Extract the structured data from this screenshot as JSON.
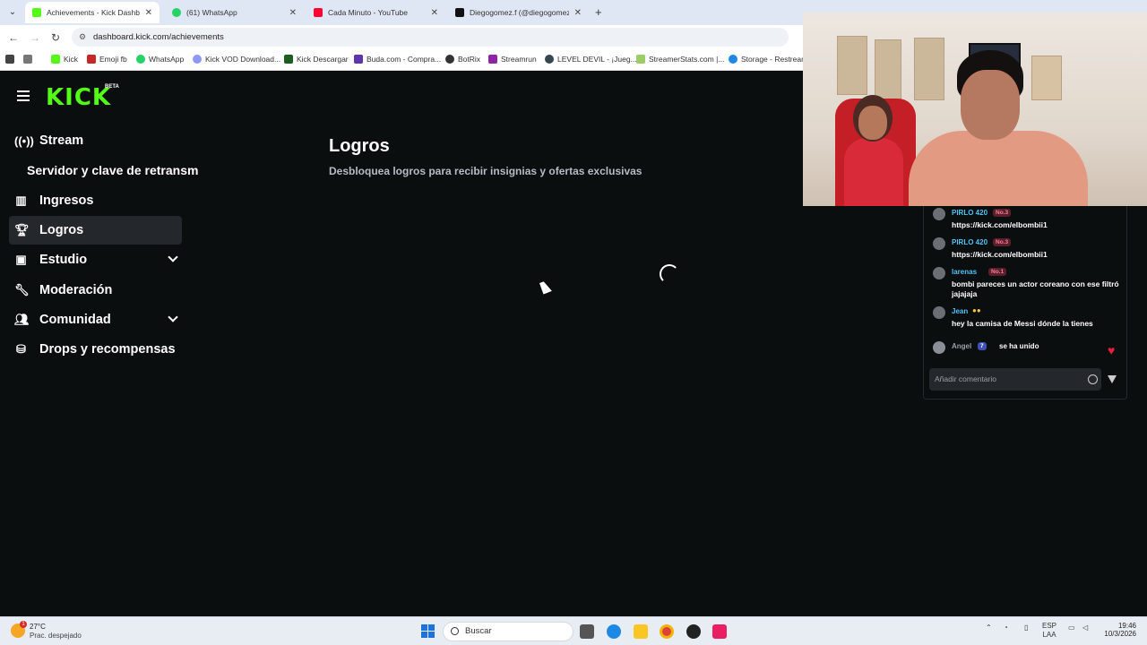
{
  "browser": {
    "tabs": [
      {
        "label": "Achievements - Kick Dashboard",
        "color": "#53fc18",
        "active": true
      },
      {
        "label": "(61) WhatsApp",
        "color": "#25d366",
        "active": false
      },
      {
        "label": "Cada Minuto - YouTube",
        "color": "#ff0033",
        "active": false
      },
      {
        "label": "Diegogomez.f (@diegogomez.f",
        "color": "#111111",
        "active": false
      }
    ],
    "new_tab": "+",
    "url": "dashboard.kick.com/achievements",
    "bookmarks": [
      "Kick",
      "Emoji fb",
      "WhatsApp",
      "Kick VOD Download...",
      "Kick Descargar",
      "Buda.com - Compra...",
      "BotRix",
      "Streamrun",
      "LEVEL DEVIL - ¡Jueg...",
      "StreamerStats.com |...",
      "Storage - Restream"
    ]
  },
  "kick": {
    "logo": "KICK",
    "beta": "BETA",
    "sidebar": [
      {
        "label": "Stream",
        "icon": "broadcast-icon"
      },
      {
        "label": "Servidor y clave de retransm",
        "icon": ""
      },
      {
        "label": "Ingresos",
        "icon": "chart-icon"
      },
      {
        "label": "Logros",
        "icon": "trophy-icon",
        "active": true
      },
      {
        "label": "Estudio",
        "icon": "studio-icon",
        "expandable": true
      },
      {
        "label": "Moderación",
        "icon": "wrench-icon"
      },
      {
        "label": "Comunidad",
        "icon": "people-icon",
        "expandable": true
      },
      {
        "label": "Drops y recompensas",
        "icon": "gift-icon"
      }
    ],
    "page_title": "Logros",
    "page_subtitle": "Desbloquea logros para recibir insignias y ofertas exclusivas"
  },
  "chat": {
    "messages": [
      {
        "user": "PIRLO 420",
        "badge": "No.3",
        "text": "https://kick.com/elbombii1",
        "color": "#4fc3f7"
      },
      {
        "user": "PIRLO 420",
        "badge": "No.3",
        "text": "https://kick.com/elbombii1",
        "color": "#4fc3f7"
      },
      {
        "user": "larenas",
        "badge": "No.1",
        "text": "bombi pareces un actor coreano con ese filtró jajajaja",
        "color": "#4fc3f7"
      },
      {
        "user": "Jean",
        "badge": "",
        "text": "hey la camisa de Messi dónde la tienes",
        "color": "#4fc3f7"
      }
    ],
    "join": {
      "user": "Angel",
      "level": "7",
      "text": "se ha unido"
    },
    "placeholder": "Añadir comentario"
  },
  "taskbar": {
    "temperature": "27°C",
    "condition": "Prac. despejado",
    "notification_count": "1",
    "search": "Buscar",
    "language": "ESP",
    "layout": "LAA",
    "time": "19:46",
    "date": "10/3/2026"
  }
}
